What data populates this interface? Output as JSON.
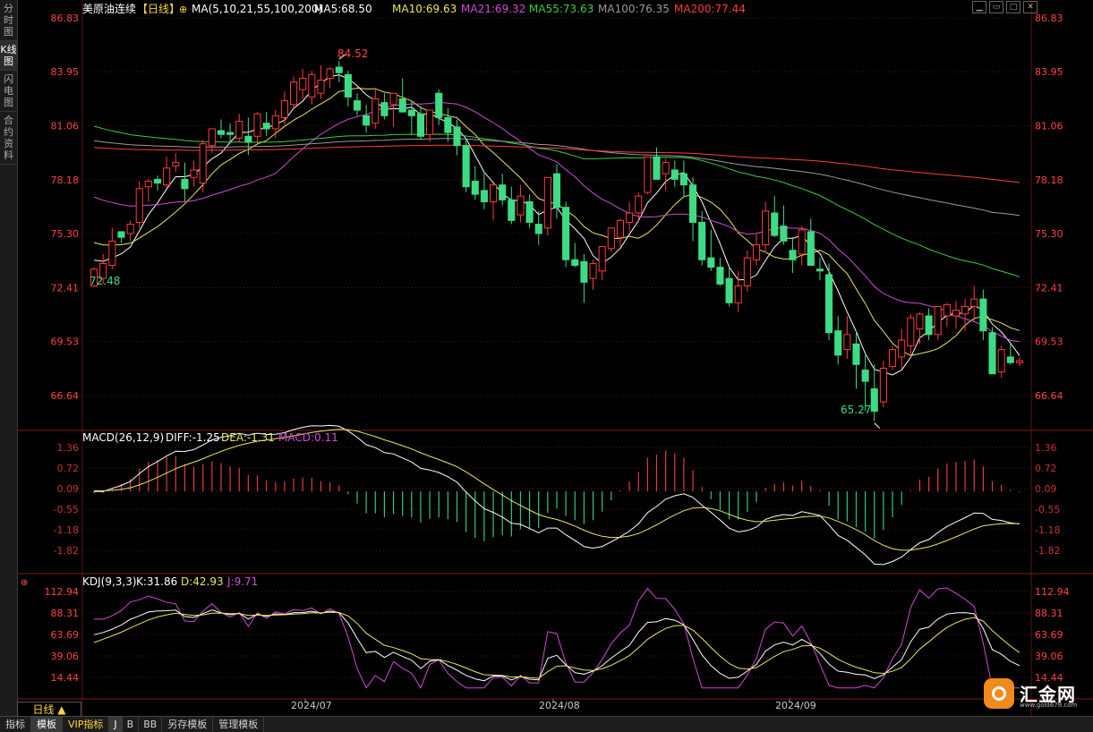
{
  "sidebar": {
    "tabs": [
      {
        "label": "分时图",
        "active": false
      },
      {
        "label": "K线图",
        "active": true
      },
      {
        "label": "闪电图",
        "active": false
      },
      {
        "label": "合约资料",
        "active": false
      }
    ]
  },
  "main": {
    "symbol": "美原油连续",
    "period": "【日线】",
    "indicator_name": "MA(5,10,21,55,100,200)",
    "ma_values": [
      {
        "label": "MA5:68.50",
        "color": "#ffffff"
      },
      {
        "label": "MA10:69.63",
        "color": "#e8e85a"
      },
      {
        "label": "MA21:69.32",
        "color": "#d04cd6"
      },
      {
        "label": "MA55:73.63",
        "color": "#3ccf3c"
      },
      {
        "label": "MA100:76.35",
        "color": "#9a9a9a"
      },
      {
        "label": "MA200:77.44",
        "color": "#ff3c3c"
      }
    ],
    "y_ticks": [
      "86.83",
      "83.95",
      "81.06",
      "78.18",
      "75.30",
      "72.41",
      "69.53",
      "66.64"
    ],
    "high_label": "84.52",
    "low_label": "65.27",
    "start_low_label": "72.48"
  },
  "macd": {
    "title": "MACD(26,12,9)",
    "diff": "DIFF:-1.25",
    "dea": "DEA:-1.31",
    "macd": "MACD:0.11",
    "y_ticks": [
      "1.36",
      "0.72",
      "0.09",
      "-0.55",
      "-1.18",
      "-1.82"
    ]
  },
  "kdj": {
    "title": "KDJ(9,3,3)",
    "k": "K:31.86",
    "d": "D:42.93",
    "j": "J:9.71",
    "y_ticks": [
      "112.94",
      "88.31",
      "63.69",
      "39.06",
      "14.44"
    ]
  },
  "x_axis": {
    "labels": [
      "2024/07",
      "2024/08",
      "2024/09"
    ]
  },
  "bottom": {
    "period_label": "日线 ▲",
    "tabs": [
      {
        "label": "指标",
        "active": false
      },
      {
        "label": "模板",
        "active": true
      },
      {
        "label": "VIP指标",
        "active": false
      },
      {
        "label": "J",
        "active": false
      },
      {
        "label": "B",
        "active": false
      },
      {
        "label": "BB",
        "active": false
      },
      {
        "label": "另存模板",
        "active": false
      },
      {
        "label": "管理模板",
        "active": false
      }
    ]
  },
  "logo": {
    "name": "汇金网",
    "url": "www.gold678.com"
  },
  "tool_icons": [
    "minimize-icon",
    "restore-icon",
    "maximize-icon",
    "close-icon"
  ],
  "colors": {
    "up": "#ff3b3b",
    "down": "#3ddc84",
    "grid": "#5a1414",
    "axis_text_red": "#ff4444",
    "axis_text_macd": "#c83232"
  },
  "chart_data": {
    "type": "candlestick",
    "ylim": [
      64.5,
      87.5
    ],
    "candles": [
      [
        72.5,
        73.5,
        72.48,
        73.4
      ],
      [
        72.9,
        74.2,
        72.6,
        73.7
      ],
      [
        73.6,
        75.6,
        73.4,
        74.9
      ],
      [
        75.4,
        75.2,
        74.8,
        75.1
      ],
      [
        75.3,
        76.0,
        74.9,
        75.8
      ],
      [
        75.9,
        78.1,
        75.6,
        77.7
      ],
      [
        77.8,
        78.2,
        77.0,
        78.1
      ],
      [
        78.2,
        78.4,
        77.6,
        78.0
      ],
      [
        77.9,
        79.4,
        77.7,
        78.8
      ],
      [
        78.9,
        79.6,
        78.6,
        79.1
      ],
      [
        78.2,
        79.1,
        77.0,
        77.7
      ],
      [
        78.3,
        79.2,
        77.8,
        78.7
      ],
      [
        78.0,
        80.3,
        77.5,
        80.1
      ],
      [
        80.0,
        80.9,
        79.6,
        80.9
      ],
      [
        80.8,
        81.4,
        80.4,
        80.6
      ],
      [
        80.7,
        81.2,
        80.2,
        80.6
      ],
      [
        80.4,
        81.7,
        80.2,
        81.3
      ],
      [
        80.5,
        81.5,
        79.5,
        80.2
      ],
      [
        80.5,
        81.8,
        80.1,
        81.7
      ],
      [
        81.2,
        81.8,
        80.5,
        80.9
      ],
      [
        80.9,
        81.9,
        80.4,
        81.6
      ],
      [
        81.5,
        82.9,
        81.1,
        82.4
      ],
      [
        82.2,
        83.7,
        82.0,
        83.4
      ],
      [
        83.0,
        84.1,
        82.5,
        83.6
      ],
      [
        82.6,
        84.0,
        82.2,
        83.8
      ],
      [
        82.8,
        84.3,
        82.5,
        83.5
      ],
      [
        83.6,
        84.2,
        83.1,
        84.1
      ],
      [
        84.2,
        84.52,
        83.4,
        83.9
      ],
      [
        83.8,
        84.0,
        82.1,
        82.6
      ],
      [
        82.4,
        82.8,
        81.6,
        81.9
      ],
      [
        81.6,
        82.2,
        80.7,
        81.1
      ],
      [
        81.2,
        83.1,
        80.9,
        82.5
      ],
      [
        82.3,
        82.8,
        81.4,
        81.6
      ],
      [
        82.2,
        82.7,
        81.0,
        82.8
      ],
      [
        82.5,
        83.6,
        81.9,
        81.8
      ],
      [
        81.9,
        82.4,
        80.6,
        81.6
      ],
      [
        81.7,
        82.1,
        80.3,
        80.5
      ],
      [
        80.6,
        81.8,
        80.2,
        81.9
      ],
      [
        82.8,
        83.0,
        81.1,
        81.5
      ],
      [
        81.5,
        82.0,
        80.2,
        80.7
      ],
      [
        81.0,
        81.4,
        79.5,
        80.0
      ],
      [
        80.0,
        80.4,
        77.5,
        77.8
      ],
      [
        78.1,
        78.9,
        77.1,
        77.4
      ],
      [
        77.6,
        78.6,
        76.6,
        77.0
      ],
      [
        77.0,
        77.9,
        76.0,
        77.9
      ],
      [
        77.9,
        78.5,
        76.8,
        77.1
      ],
      [
        77.1,
        77.8,
        75.8,
        76.0
      ],
      [
        76.3,
        77.9,
        75.9,
        77.3
      ],
      [
        77.0,
        77.4,
        75.6,
        75.9
      ],
      [
        75.8,
        76.5,
        74.7,
        75.3
      ],
      [
        75.6,
        78.3,
        75.2,
        78.3
      ],
      [
        78.5,
        79.0,
        76.1,
        76.7
      ],
      [
        76.7,
        77.0,
        73.5,
        73.9
      ],
      [
        73.9,
        74.8,
        73.5,
        73.6
      ],
      [
        73.8,
        74.2,
        71.6,
        72.7
      ],
      [
        72.9,
        73.9,
        72.3,
        73.7
      ],
      [
        73.3,
        74.3,
        72.8,
        74.6
      ],
      [
        74.5,
        75.4,
        74.3,
        75.6
      ],
      [
        75.1,
        76.1,
        74.6,
        76.0
      ],
      [
        75.9,
        77.0,
        75.4,
        76.4
      ],
      [
        76.4,
        77.5,
        75.9,
        77.3
      ],
      [
        77.5,
        79.4,
        77.4,
        79.4
      ],
      [
        79.4,
        79.9,
        78.3,
        78.2
      ],
      [
        78.5,
        79.3,
        77.6,
        79.1
      ],
      [
        78.7,
        79.2,
        77.8,
        78.2
      ],
      [
        78.5,
        79.2,
        77.3,
        77.9
      ],
      [
        77.9,
        78.3,
        74.9,
        75.9
      ],
      [
        75.9,
        76.5,
        73.6,
        73.9
      ],
      [
        74.0,
        75.5,
        73.3,
        73.5
      ],
      [
        73.5,
        74.0,
        72.5,
        72.6
      ],
      [
        72.9,
        73.6,
        71.4,
        71.6
      ],
      [
        71.6,
        73.3,
        71.1,
        72.5
      ],
      [
        72.5,
        74.4,
        72.2,
        74.0
      ],
      [
        73.9,
        75.3,
        73.6,
        74.7
      ],
      [
        74.7,
        77.0,
        74.3,
        76.5
      ],
      [
        76.4,
        77.3,
        75.1,
        75.2
      ],
      [
        75.7,
        76.8,
        74.7,
        74.9
      ],
      [
        74.4,
        75.1,
        73.2,
        73.9
      ],
      [
        74.2,
        75.7,
        73.6,
        75.5
      ],
      [
        75.4,
        76.1,
        73.8,
        73.6
      ],
      [
        73.4,
        74.0,
        72.8,
        73.3
      ],
      [
        73.1,
        73.7,
        69.6,
        70.0
      ],
      [
        70.1,
        70.9,
        68.3,
        68.8
      ],
      [
        69.1,
        70.9,
        68.6,
        69.9
      ],
      [
        69.4,
        70.1,
        67.0,
        68.3
      ],
      [
        68.0,
        68.8,
        65.8,
        67.4
      ],
      [
        67.0,
        68.3,
        65.27,
        65.8
      ],
      [
        66.3,
        68.5,
        66.0,
        68.1
      ],
      [
        68.2,
        69.3,
        68.0,
        69.1
      ],
      [
        68.7,
        70.2,
        68.0,
        69.6
      ],
      [
        69.3,
        71.0,
        68.7,
        70.8
      ],
      [
        70.2,
        71.1,
        69.4,
        71.0
      ],
      [
        70.9,
        71.3,
        69.6,
        69.9
      ],
      [
        69.9,
        71.4,
        69.6,
        71.4
      ],
      [
        70.9,
        71.6,
        70.3,
        71.5
      ],
      [
        70.9,
        71.7,
        70.2,
        71.2
      ],
      [
        71.0,
        71.8,
        70.1,
        71.4
      ],
      [
        71.4,
        72.5,
        70.6,
        71.8
      ],
      [
        71.8,
        72.3,
        69.6,
        70.1
      ],
      [
        70.0,
        70.3,
        67.9,
        67.8
      ],
      [
        67.9,
        69.3,
        67.6,
        69.1
      ],
      [
        68.7,
        69.5,
        68.3,
        68.4
      ],
      [
        68.4,
        68.7,
        68.2,
        68.5
      ]
    ]
  }
}
